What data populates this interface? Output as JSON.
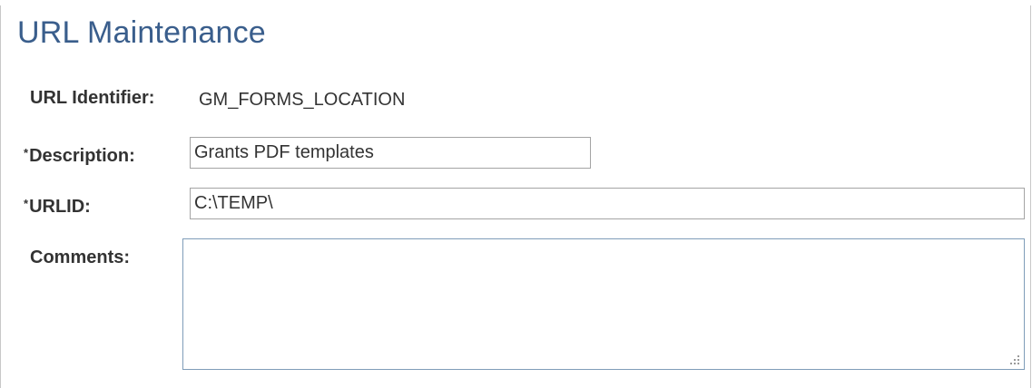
{
  "page": {
    "title": "URL Maintenance"
  },
  "form": {
    "url_identifier": {
      "label": "URL Identifier:",
      "value": "GM_FORMS_LOCATION"
    },
    "description": {
      "required_marker": "*",
      "label": "Description:",
      "value": "Grants PDF templates"
    },
    "urlid": {
      "required_marker": "*",
      "label": "URLID:",
      "value": "C:\\TEMP\\"
    },
    "comments": {
      "label": "Comments:",
      "value": ""
    }
  },
  "colors": {
    "title": "#3a5e8c",
    "label": "#333333",
    "field_border": "#a4a4a4",
    "textarea_border": "#7f9db9"
  },
  "icons": {
    "resize_grip": "resize-grip-icon"
  }
}
